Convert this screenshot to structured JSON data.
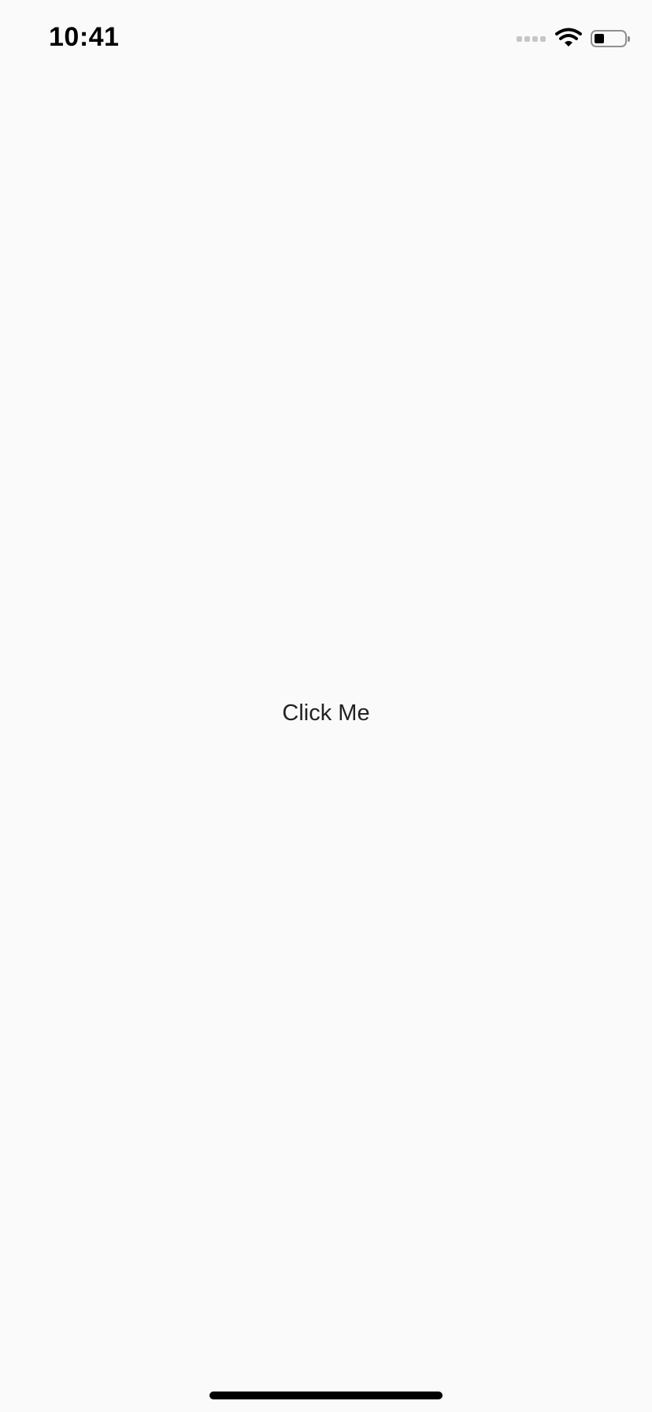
{
  "status_bar": {
    "time": "10:41",
    "signal_icon": "signal-bars-icon",
    "wifi_icon": "wifi-icon",
    "battery_icon": "battery-icon",
    "battery_level": 0.25
  },
  "main": {
    "button_label": "Click Me"
  },
  "colors": {
    "background": "#fafafa",
    "text": "#222222",
    "status_text": "#000000"
  }
}
